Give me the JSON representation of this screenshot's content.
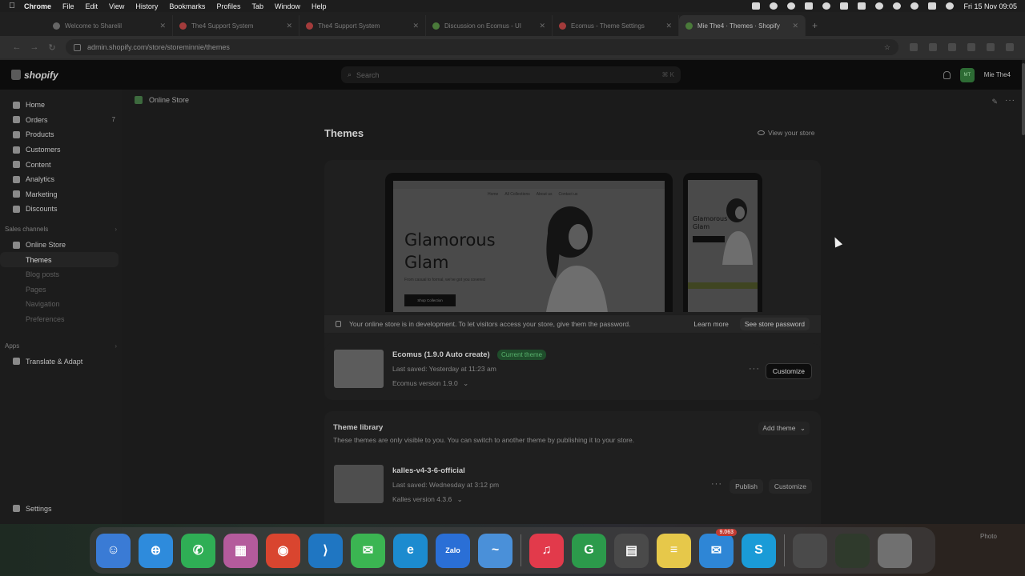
{
  "menubar": {
    "app": "Chrome",
    "items": [
      "File",
      "Edit",
      "View",
      "History",
      "Bookmarks",
      "Profiles",
      "Tab",
      "Window",
      "Help"
    ],
    "clock": "Fri 15 Nov  09:05"
  },
  "tabs": [
    {
      "title": "Welcome to Sharelil",
      "color": "#666666"
    },
    {
      "title": "The4 Support System",
      "color": "#a33b3b"
    },
    {
      "title": "The4 Support System",
      "color": "#a33b3b"
    },
    {
      "title": "Discussion on Ecomus - UI",
      "color": "#4a7a3a"
    },
    {
      "title": "Ecomus - Theme Settings",
      "color": "#a33b3b"
    },
    {
      "title": "Mie The4 · Themes · Shopify",
      "color": "#4a7a3a"
    }
  ],
  "new_tab": "+",
  "address": {
    "url": "admin.shopify.com/store/storeminnie/themes"
  },
  "shopify": {
    "logo": "shopify",
    "search_placeholder": "Search",
    "search_shortcut": "⌘ K",
    "store_name": "Mie The4",
    "avatar_initials": "MT"
  },
  "sidebar": {
    "main": [
      {
        "label": "Home",
        "count": ""
      },
      {
        "label": "Orders",
        "count": "7"
      },
      {
        "label": "Products",
        "count": ""
      },
      {
        "label": "Customers",
        "count": ""
      },
      {
        "label": "Content",
        "count": ""
      },
      {
        "label": "Analytics",
        "count": ""
      },
      {
        "label": "Marketing",
        "count": ""
      },
      {
        "label": "Discounts",
        "count": ""
      }
    ],
    "sales_channels_label": "Sales channels",
    "online_store": "Online Store",
    "sub": [
      "Themes",
      "Blog posts",
      "Pages",
      "Navigation",
      "Preferences"
    ],
    "apps_label": "Apps",
    "apps": [
      "Translate & Adapt"
    ],
    "settings": "Settings"
  },
  "breadcrumb": "Online Store",
  "page": {
    "title": "Themes",
    "view_store": "View your store"
  },
  "preview": {
    "hero_title_1": "Glamorous",
    "hero_title_2": "Glam",
    "hero_sub": "From casual to formal, we've got you covered",
    "hero_button": "Shop Collection",
    "menu": [
      "Home",
      "All Collections",
      "About us",
      "Contact us"
    ]
  },
  "dev_banner": {
    "text": "Your online store is in development. To let visitors access your store, give them the password.",
    "learn_more": "Learn more",
    "password_button": "See store password"
  },
  "current_theme": {
    "name": "Ecomus (1.9.0 Auto create)",
    "badge": "Current theme",
    "last_saved": "Last saved: Yesterday at 11:23 am",
    "version": "Ecomus version 1.9.0",
    "customize": "Customize"
  },
  "library": {
    "title": "Theme library",
    "subtitle": "These themes are only visible to you. You can switch to another theme by publishing it to your store.",
    "add_theme": "Add theme",
    "themes": [
      {
        "name": "kalles-v4-3-6-official",
        "last_saved": "Last saved: Wednesday at 3:12 pm",
        "version": "Kalles version 4.3.6",
        "publish": "Publish",
        "customize": "Customize"
      }
    ]
  },
  "dock": {
    "apps": [
      {
        "name": "finder",
        "glyph": "☺",
        "color": "#3a7bd5"
      },
      {
        "name": "safari",
        "glyph": "⊕",
        "color": "#2e8bdc"
      },
      {
        "name": "whatsapp",
        "glyph": "✆",
        "color": "#2fae55"
      },
      {
        "name": "launchpad",
        "glyph": "▦",
        "color": "#b45b9c"
      },
      {
        "name": "chrome",
        "glyph": "◉",
        "color": "#d9452f"
      },
      {
        "name": "vscode",
        "glyph": "⟩",
        "color": "#1f76c2"
      },
      {
        "name": "messages",
        "glyph": "✉",
        "color": "#3bb552"
      },
      {
        "name": "edge",
        "glyph": "e",
        "color": "#1c8bcf"
      },
      {
        "name": "zalo",
        "glyph": "Zalo",
        "color": "#2a6fd6"
      },
      {
        "name": "freeform",
        "glyph": "~",
        "color": "#4a90d9"
      },
      {
        "name": "music",
        "glyph": "♫",
        "color": "#e23a4b"
      },
      {
        "name": "sheets",
        "glyph": "G",
        "color": "#2c9a4b"
      },
      {
        "name": "calculator",
        "glyph": "▤",
        "color": "#4a4a4a"
      },
      {
        "name": "notes",
        "glyph": "≡",
        "color": "#e6c84a"
      },
      {
        "name": "mail",
        "glyph": "✉",
        "color": "#2e86d6",
        "badge": "9.063"
      },
      {
        "name": "skype",
        "glyph": "S",
        "color": "#1a9bd7"
      }
    ],
    "photo_label": "Photo"
  }
}
